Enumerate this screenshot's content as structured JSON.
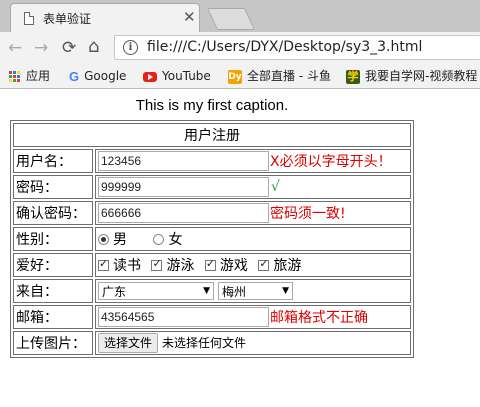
{
  "browser": {
    "tab_title": "表单验证",
    "url": "file:///C:/Users/DYX/Desktop/sy3_3.html",
    "bookmarks": [
      "应用",
      "Google",
      "YouTube",
      "全部直播 - 斗鱼",
      "我要自学网-视频教程"
    ],
    "bookmark_icon_text": {
      "douyu": "Dy",
      "zixue": "学"
    }
  },
  "page": {
    "caption": "This is my first caption.",
    "table_header": "用户注册",
    "rows": {
      "username": {
        "label": "用户名：",
        "value": "123456",
        "message": "X必须以字母开头！"
      },
      "password": {
        "label": "密码：",
        "value": "999999",
        "message": "√"
      },
      "confirm": {
        "label": "确认密码：",
        "value": "666666",
        "message": "密码须一致!"
      },
      "gender": {
        "label": "性别：",
        "options": [
          "男",
          "女"
        ],
        "selected": "男"
      },
      "hobby": {
        "label": "爱好：",
        "options": [
          "读书",
          "游泳",
          "游戏",
          "旅游"
        ],
        "checked": [
          "读书",
          "游泳",
          "游戏",
          "旅游"
        ]
      },
      "origin": {
        "label": "来自：",
        "province": "广东",
        "city": "梅州"
      },
      "email": {
        "label": "邮箱：",
        "value": "43564565",
        "message": "邮箱格式不正确"
      },
      "upload": {
        "label": "上传图片：",
        "button": "选择文件",
        "status": "未选择任何文件"
      }
    }
  },
  "colors": {
    "error": "#e00000",
    "ok": "#2a9d2a"
  }
}
